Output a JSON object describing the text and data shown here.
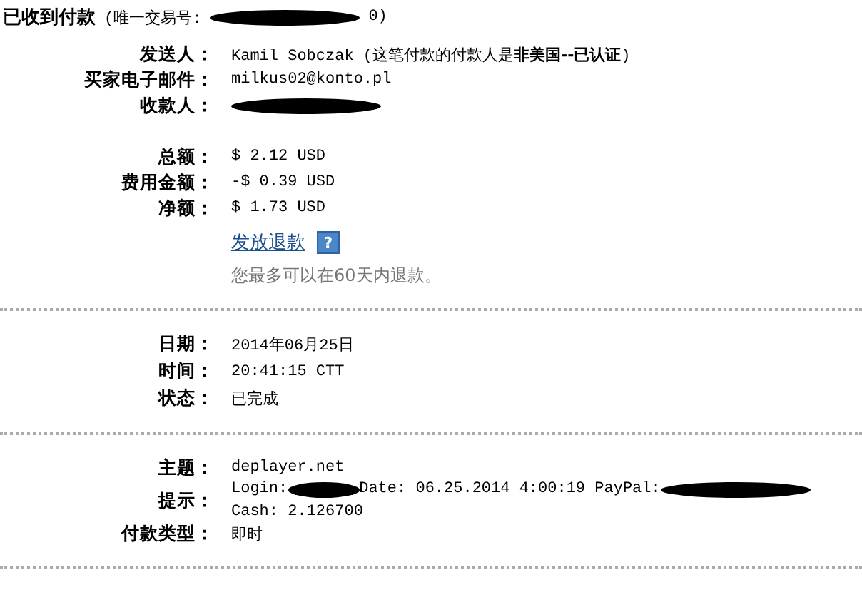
{
  "header": {
    "title": "已收到付款",
    "parts": [
      {
        "kind": "text",
        "text": "(唯一交易号:"
      },
      {
        "kind": "redacted_long"
      },
      {
        "kind": "text",
        "text": "0)"
      }
    ]
  },
  "sections": [
    {
      "groups": [
        {
          "rows": [
            {
              "kind": "field",
              "label": "发送人：",
              "lines": [
                [
                  {
                    "kind": "text",
                    "text": "Kamil Sobczak (这笔付款的付款人是**非美国--已认证**)"
                  }
                ]
              ]
            },
            {
              "kind": "field",
              "label": "买家电子邮件：",
              "lines": [
                [
                  {
                    "kind": "text",
                    "text": "milkus02@konto.pl"
                  }
                ]
              ]
            },
            {
              "kind": "field",
              "label": "收款人：",
              "lines": [
                [
                  {
                    "kind": "redacted_long"
                  }
                ]
              ]
            }
          ]
        },
        {
          "rows": [
            {
              "kind": "field",
              "label": "总额：",
              "lines": [
                [
                  {
                    "kind": "text",
                    "text": "$ 2.12 USD"
                  }
                ]
              ]
            },
            {
              "kind": "field",
              "label": "费用金额：",
              "lines": [
                [
                  {
                    "kind": "text",
                    "text": "-$ 0.39 USD"
                  }
                ]
              ]
            },
            {
              "kind": "field",
              "label": "净额：",
              "lines": [
                [
                  {
                    "kind": "text",
                    "text": "$ 1.73 USD"
                  }
                ]
              ]
            },
            {
              "kind": "link",
              "text": "发放退款",
              "help": "?"
            },
            {
              "kind": "note",
              "text": "您最多可以在60天内退款。"
            }
          ]
        }
      ]
    },
    {
      "groups": [
        {
          "rows": [
            {
              "kind": "field",
              "label": "日期：",
              "lines": [
                [
                  {
                    "kind": "text",
                    "text": "2014年06月25日"
                  }
                ]
              ]
            },
            {
              "kind": "field",
              "label": "时间：",
              "lines": [
                [
                  {
                    "kind": "text",
                    "text": "20:41:15 CTT"
                  }
                ]
              ]
            },
            {
              "kind": "field",
              "label": "状态：",
              "lines": [
                [
                  {
                    "kind": "text",
                    "text": "已完成"
                  }
                ]
              ]
            }
          ]
        }
      ]
    },
    {
      "groups": [
        {
          "rows": [
            {
              "kind": "field",
              "label": "主题：",
              "lines": [
                [
                  {
                    "kind": "text",
                    "text": "deplayer.net"
                  }
                ]
              ]
            },
            {
              "kind": "field",
              "label": "提示：",
              "lines": [
                [
                  {
                    "kind": "text",
                    "text": "Login:"
                  },
                  {
                    "kind": "redacted_short"
                  },
                  {
                    "kind": "text",
                    "text": "Date: 06.25.2014 4:00:19 PayPal:"
                  },
                  {
                    "kind": "redacted_long"
                  }
                ],
                [
                  {
                    "kind": "text",
                    "text": "Cash: 2.126700"
                  }
                ]
              ]
            },
            {
              "kind": "field",
              "label": "付款类型：",
              "lines": [
                [
                  {
                    "kind": "text",
                    "text": "即时"
                  }
                ]
              ]
            }
          ]
        }
      ]
    }
  ]
}
